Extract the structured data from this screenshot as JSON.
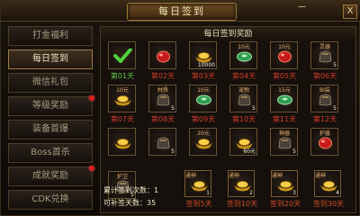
{
  "window": {
    "title": "每日签到",
    "close_label": "X",
    "top_text": "一"
  },
  "sidebar": {
    "items": [
      {
        "label": "打金福利",
        "active": false,
        "dot": false
      },
      {
        "label": "每日签到",
        "active": true,
        "dot": false
      },
      {
        "label": "微信礼包",
        "active": false,
        "dot": false
      },
      {
        "label": "等级奖励",
        "active": false,
        "dot": true
      },
      {
        "label": "装备首爆",
        "active": false,
        "dot": false
      },
      {
        "label": "Boss首杀",
        "active": false,
        "dot": false
      },
      {
        "label": "成就奖励",
        "active": false,
        "dot": true
      },
      {
        "label": "CDK兑换",
        "active": false,
        "dot": false
      }
    ]
  },
  "rewards": {
    "header": "每日签到奖励",
    "days": [
      {
        "day": "第01天",
        "icon": "check-icon",
        "label": "",
        "qty": "",
        "claimed": true
      },
      {
        "day": "第02天",
        "icon": "red-gem-icon",
        "label": "",
        "qty": "",
        "claimed": false
      },
      {
        "day": "第03天",
        "icon": "gold-ingot-icon",
        "label": "",
        "qty": "10000",
        "claimed": false
      },
      {
        "day": "第04天",
        "icon": "jade-icon",
        "label": "10元",
        "qty": "",
        "claimed": false
      },
      {
        "day": "第05天",
        "icon": "red-gem-icon",
        "label": "10元",
        "qty": "",
        "claimed": false
      },
      {
        "day": "第06天",
        "icon": "pouch-icon",
        "label": "灵器",
        "qty": "5",
        "claimed": false
      },
      {
        "day": "第07天",
        "icon": "gold-ingot-icon",
        "label": "10元",
        "qty": "",
        "claimed": false
      },
      {
        "day": "第08天",
        "icon": "pouch-icon",
        "label": "材质",
        "qty": "5",
        "claimed": false
      },
      {
        "day": "第09天",
        "icon": "jade-icon",
        "label": "10元",
        "qty": "",
        "claimed": false
      },
      {
        "day": "第10天",
        "icon": "pouch-icon",
        "label": "宠物",
        "qty": "5",
        "claimed": false
      },
      {
        "day": "第11天",
        "icon": "jade-icon",
        "label": "15元",
        "qty": "",
        "claimed": false
      },
      {
        "day": "第12天",
        "icon": "pouch-icon",
        "label": "BI装",
        "qty": "5",
        "claimed": false
      },
      {
        "day": "",
        "icon": "gold-ingot-icon",
        "label": "",
        "qty": "",
        "claimed": false
      },
      {
        "day": "",
        "icon": "pouch-icon",
        "label": "",
        "qty": "5",
        "claimed": false
      },
      {
        "day": "",
        "icon": "gold-ingot-icon",
        "label": "20元",
        "qty": "",
        "claimed": false
      },
      {
        "day": "",
        "icon": "gold-ingot-icon",
        "label": "",
        "qty": "60元",
        "claimed": false
      },
      {
        "day": "",
        "icon": "pouch-icon",
        "label": "神器",
        "qty": "5",
        "claimed": false
      },
      {
        "day": "",
        "icon": "red-gem-icon",
        "label": "护盾",
        "qty": "",
        "claimed": false
      },
      {
        "day": "",
        "icon": "pouch-icon",
        "label": "护卫",
        "qty": "5",
        "claimed": false
      }
    ]
  },
  "stats": {
    "total_label": "累计签到次数：",
    "total_value": "1",
    "can_sign_label": "可补签天",
    "can_sign_value": "数：35"
  },
  "bonus_boxes": [
    {
      "tag": "通神",
      "index": "1",
      "label": "签到5天"
    },
    {
      "tag": "通神",
      "index": "2",
      "label": "签到10天"
    },
    {
      "tag": "通神",
      "index": "3",
      "label": "签到20天"
    },
    {
      "tag": "通神",
      "index": "4",
      "label": "签到30天"
    }
  ]
}
